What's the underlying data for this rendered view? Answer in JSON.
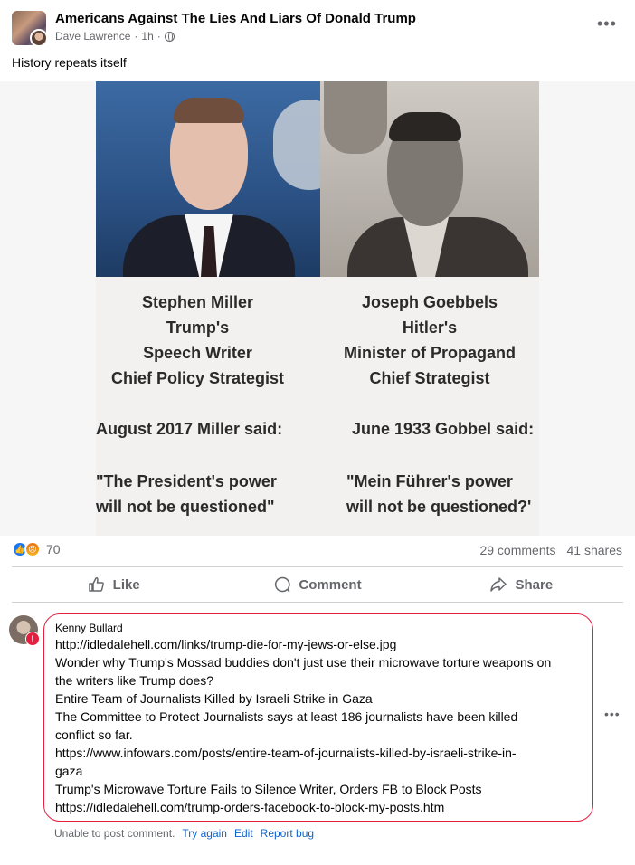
{
  "post": {
    "group_name": "Americans Against The Lies And Liars Of Donald Trump",
    "author": "Dave Lawrence",
    "time": "1h",
    "separator": "·",
    "text": "History repeats itself"
  },
  "meme": {
    "left_lines": [
      "Stephen Miller",
      "Trump's",
      "Speech Writer",
      "Chief Policy Strategist"
    ],
    "right_lines": [
      "Joseph Goebbels",
      "Hitler's",
      "Minister of Propagand",
      "Chief Strategist"
    ],
    "left_said": "August 2017 Miller said:",
    "right_said": "June 1933 Gobbel said:",
    "left_quote": [
      "\"The President's power",
      "will not be questioned\""
    ],
    "right_quote": [
      "\"Mein Führer's power",
      "will not be questioned?'"
    ]
  },
  "stats": {
    "reaction_count": "70",
    "comments": "29 comments",
    "shares": "41 shares"
  },
  "actions": {
    "like": "Like",
    "comment": "Comment",
    "share": "Share"
  },
  "comment": {
    "author": "Kenny Bullard",
    "lines": [
      "http://idledalehell.com/links/trump-die-for-my-jews-or-else.jpg",
      "Wonder why Trump's Mossad buddies don't just use their microwave torture weapons on",
      "the writers like Trump does?",
      "Entire Team of Journalists Killed by Israeli Strike in Gaza",
      "The Committee to Protect Journalists says at least 186 journalists have been killed",
      "conflict so far.",
      "https://www.infowars.com/posts/entire-team-of-journalists-killed-by-israeli-strike-in-",
      "gaza",
      "Trump's Microwave Torture Fails to Silence Writer, Orders FB to Block Posts",
      "https://idledalehell.com/trump-orders-facebook-to-block-my-posts.htm"
    ],
    "status": "Unable to post comment.",
    "try_again": "Try again",
    "edit": "Edit",
    "report_bug": "Report bug"
  },
  "colors": {
    "error": "#e41e3f",
    "like_blue": "#1877f2",
    "link": "#0f62c9",
    "secondary_text": "#65676b"
  }
}
